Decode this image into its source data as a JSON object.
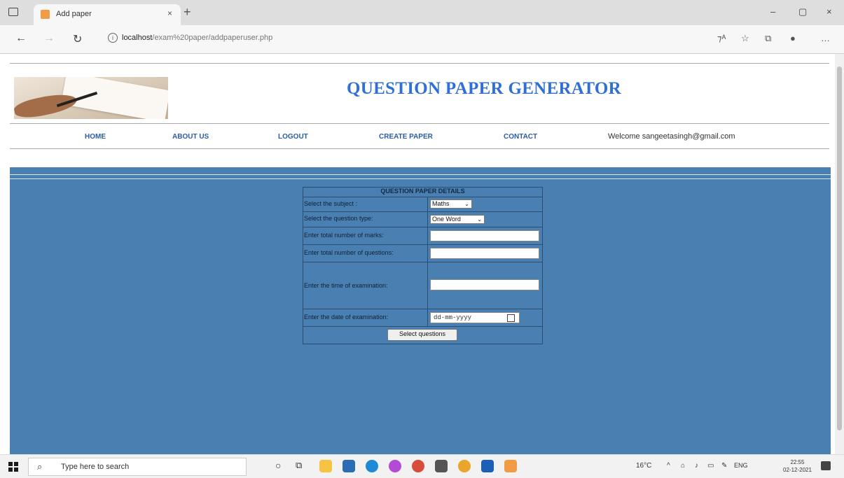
{
  "browser": {
    "tab_title": "Add paper",
    "tab_close": "×",
    "new_tab": "+",
    "url_host": "localhost",
    "url_path": "/exam%20paper/addpaperuser.php",
    "window_controls": [
      "–",
      "▢",
      "×"
    ]
  },
  "header": {
    "title": "QUESTION PAPER GENERATOR",
    "logo_icon": "exam-paper-logo"
  },
  "nav": {
    "items": [
      {
        "label": "HOME"
      },
      {
        "label": "ABOUT US"
      },
      {
        "label": "LOGOUT"
      },
      {
        "label": "CREATE PAPER"
      },
      {
        "label": "CONTACT"
      }
    ],
    "welcome": "Welcome sangeetasingh@gmail.com"
  },
  "form": {
    "heading": "QUESTION PAPER DETAILS",
    "subject_label": "Select the subject :",
    "subject_value": "Maths",
    "qtype_label": "Select the question type:",
    "qtype_value": "One Word",
    "marks_label": "Enter total number of marks:",
    "questions_label": "Enter total number of questions:",
    "time_label": "Enter the time of examination:",
    "date_label": "Enter the date of examination:",
    "date_placeholder": "dd-mm-yyyy",
    "submit_label": "Select questions"
  },
  "taskbar": {
    "search_placeholder": "Type here to search",
    "weather": "16°C",
    "lang": "ENG",
    "time": "22:55",
    "date": "02-12-2021"
  },
  "colors": {
    "page_blue": "#4a7fb2",
    "title_blue": "#2f6fd6",
    "nav_blue": "#2a5caa"
  }
}
